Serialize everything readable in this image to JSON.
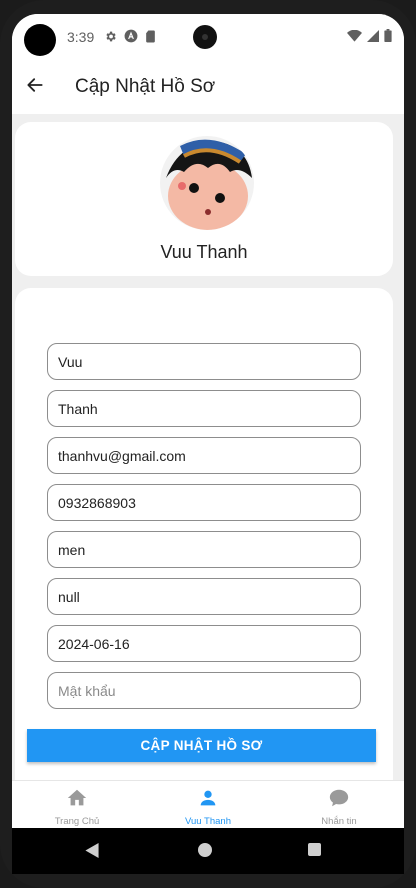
{
  "status_bar": {
    "time": "3:39",
    "left_icons": [
      "gear-icon",
      "a-badge-icon",
      "sim-card-icon"
    ],
    "right_icons": [
      "wifi-icon",
      "signal-icon",
      "battery-icon"
    ]
  },
  "app_bar": {
    "title": "Cập Nhật Hồ Sơ",
    "back_icon": "arrow-back-icon"
  },
  "profile": {
    "name": "Vuu Thanh",
    "avatar": "cartoon-girl-avatar"
  },
  "form": {
    "fields": [
      {
        "name": "first-name-field",
        "value": "Vuu",
        "placeholder": ""
      },
      {
        "name": "last-name-field",
        "value": "Thanh",
        "placeholder": ""
      },
      {
        "name": "email-field",
        "value": "thanhvu@gmail.com",
        "placeholder": ""
      },
      {
        "name": "phone-field",
        "value": "0932868903",
        "placeholder": ""
      },
      {
        "name": "gender-field",
        "value": "men",
        "placeholder": ""
      },
      {
        "name": "address-field",
        "value": "null",
        "placeholder": ""
      },
      {
        "name": "birthdate-field",
        "value": "2024-06-16",
        "placeholder": ""
      },
      {
        "name": "password-field",
        "value": "",
        "placeholder": "Mật khẩu"
      }
    ],
    "submit_label": "CẬP NHẬT HỒ SƠ"
  },
  "bottom_nav": {
    "items": [
      {
        "label": "Trang Chủ",
        "icon": "home-icon",
        "active": false
      },
      {
        "label": "Vuu Thanh",
        "icon": "person-icon",
        "active": true
      },
      {
        "label": "Nhắn tin",
        "icon": "chat-bubble-icon",
        "active": false
      }
    ]
  },
  "colors": {
    "accent": "#2196f3",
    "background": "#efefef",
    "card": "#ffffff",
    "inactive_nav": "#9a9a9a"
  }
}
